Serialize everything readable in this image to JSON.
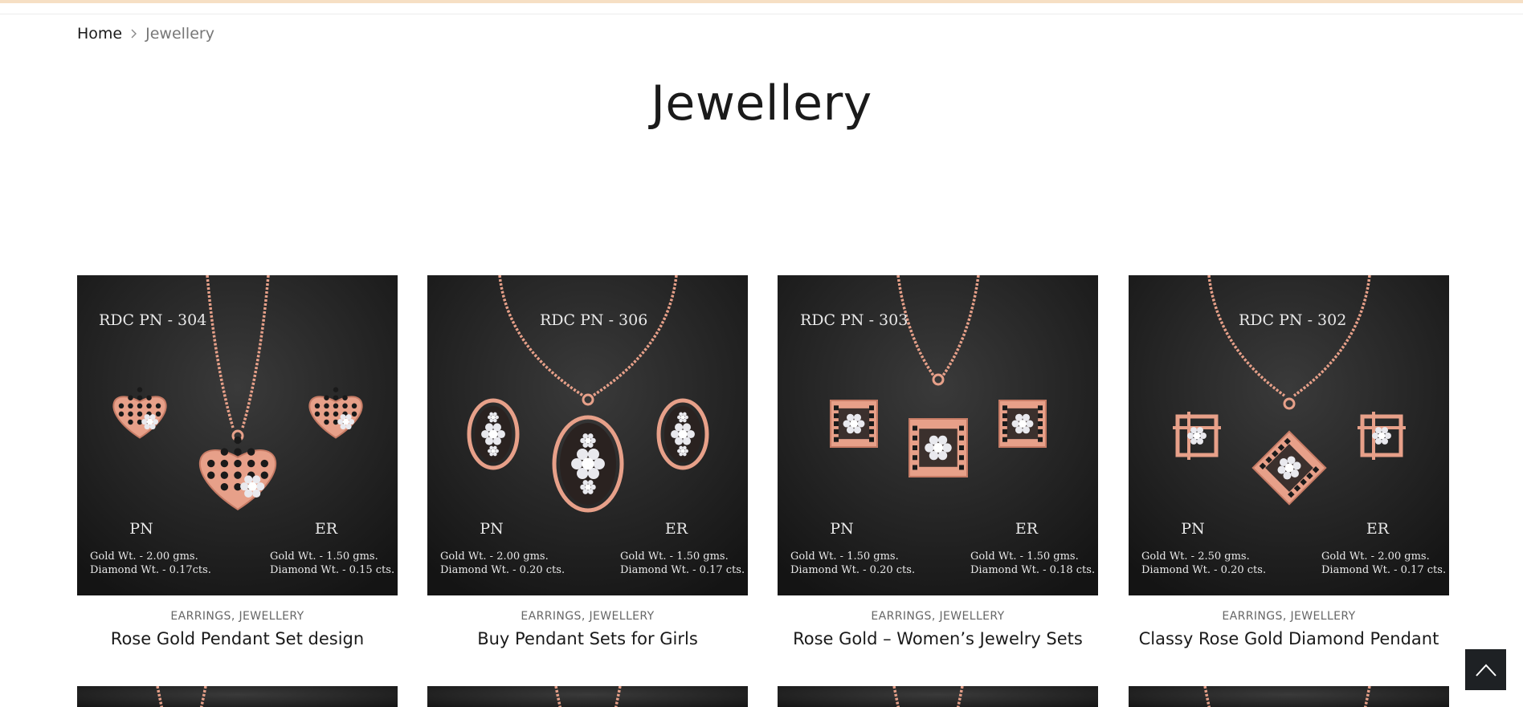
{
  "breadcrumb": {
    "home": "Home",
    "current": "Jewellery"
  },
  "page": {
    "title": "Jewellery"
  },
  "colors": {
    "accent_bar": "#f6dfc4",
    "rose_gold": "#e7a089",
    "image_bg": "#1f1f1f",
    "back_to_top_bg": "#1e2124"
  },
  "products": [
    {
      "code": "RDC PN - 304",
      "pn_gold": "Gold Wt. -  2.00 gms.",
      "pn_diamond": "Diamond Wt. - 0.17cts.",
      "er_gold": "Gold Wt. - 1.50 gms.",
      "er_diamond": "Diamond Wt. - 0.15 cts.",
      "cat1": "EARRINGS",
      "cat2": "JEWELLERY",
      "name": "Rose Gold Pendant Set design",
      "motif": "heart"
    },
    {
      "code": "RDC PN - 306",
      "pn_gold": "Gold Wt. -  2.00 gms.",
      "pn_diamond": "Diamond Wt. - 0.20 cts.",
      "er_gold": "Gold Wt. - 1.50 gms.",
      "er_diamond": "Diamond Wt. - 0.17 cts.",
      "cat1": "EARRINGS",
      "cat2": "JEWELLERY",
      "name": "Buy Pendant Sets for Girls",
      "motif": "oval"
    },
    {
      "code": "RDC PN - 303",
      "pn_gold": "Gold Wt. -  1.50 gms.",
      "pn_diamond": "Diamond Wt. - 0.20 cts.",
      "er_gold": "Gold Wt. - 1.50 gms.",
      "er_diamond": "Diamond Wt. - 0.18 cts.",
      "cat1": "EARRINGS",
      "cat2": "JEWELLERY",
      "name": "Rose Gold – Women’s Jewelry Sets",
      "motif": "square"
    },
    {
      "code": "RDC PN - 302",
      "pn_gold": "Gold Wt. - 2.50 gms.",
      "pn_diamond": "Diamond Wt. - 0.20 cts.",
      "er_gold": "Gold Wt. - 2.00 gms.",
      "er_diamond": "Diamond Wt. - 0.17 cts.",
      "cat1": "EARRINGS",
      "cat2": "JEWELLERY",
      "name": "Classy Rose Gold Diamond Pendant",
      "motif": "diamond"
    }
  ],
  "labels": {
    "pn": "PN",
    "er": "ER",
    "cat_sep": ", "
  },
  "back_to_top": {
    "icon": "chevron-up-icon"
  }
}
